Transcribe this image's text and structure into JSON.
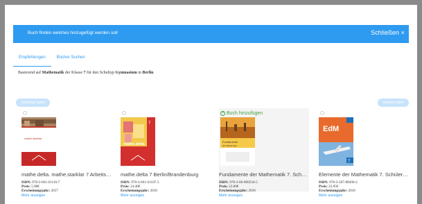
{
  "header": {
    "title": "Buch finden welches hinzugefügt werden soll",
    "close_label": "Schließen ×"
  },
  "tabs": [
    {
      "label": "Empfehlungen",
      "active": true
    },
    {
      "label": "Bücher Suchen",
      "active": false
    }
  ],
  "info": {
    "prefix": "Basierend auf",
    "subject": "Mathematik",
    "mid1": "der Klasse",
    "grade": "7",
    "mid2": "für den Schultyp",
    "school_type": "Gymnasium",
    "mid3": "in",
    "state": "Berlin"
  },
  "nav": {
    "prev_label": "Vorherige laden",
    "next_label": "Weitere laden"
  },
  "labels": {
    "isbn": "ISBN:",
    "price": "Preis:",
    "year": "Erscheinungsjahr:",
    "more": "Mehr anzeigen",
    "add": "Buch hinzufügen"
  },
  "books": [
    {
      "title": "mathe.delta. mathe.starklar 7 Arbeitsheft",
      "isbn": "978-3-661-61116-7",
      "price": "5.90€",
      "year": "2017",
      "cover_text": "mathe.starklar"
    },
    {
      "title": "mathe.delta 7 Berlin/Brandenburg",
      "isbn": "978-3-661-61107-5",
      "price": "24.40€",
      "year": "2016",
      "cover_text": "mathe.delta"
    },
    {
      "title": "Fundamente der Mathematik 7. Schülerbuch",
      "isbn": "978-3-06-009234-5",
      "price": "23.00€",
      "year": "2016",
      "cover_text": "Fundamente der Mathematik"
    },
    {
      "title": "Elemente der Mathematik 7. Schülerbuch",
      "isbn": "978-3-507-88306-2",
      "price": "23.95€",
      "year": "2016",
      "cover_text": "EdM"
    }
  ],
  "colors": {
    "accent": "#2e9bf0",
    "add_green": "#43a047"
  }
}
